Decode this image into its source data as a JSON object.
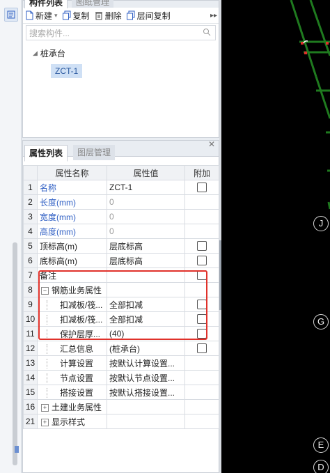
{
  "component_panel": {
    "tabs": [
      "构件列表",
      "图纸管理"
    ],
    "toolbar": {
      "new": "新建",
      "copy": "复制",
      "delete": "删除",
      "layer_copy": "层间复制"
    },
    "search_placeholder": "搜索构件...",
    "tree_root": "桩承台",
    "tree_child": "ZCT-1"
  },
  "property_panel": {
    "tabs": [
      "属性列表",
      "图层管理"
    ],
    "headers": {
      "name": "属性名称",
      "value": "属性值",
      "extra": "附加"
    },
    "rows": [
      {
        "num": "1",
        "name": "名称",
        "value": "ZCT-1",
        "check": true
      },
      {
        "num": "2",
        "name": "长度(mm)",
        "value": "0"
      },
      {
        "num": "3",
        "name": "宽度(mm)",
        "value": "0"
      },
      {
        "num": "4",
        "name": "高度(mm)",
        "value": "0"
      },
      {
        "num": "5",
        "name": "顶标高(m)",
        "value": "层底标高",
        "check": true
      },
      {
        "num": "6",
        "name": "底标高(m)",
        "value": "层底标高",
        "check": true
      },
      {
        "num": "7",
        "name": "备注",
        "value": "",
        "check": true
      },
      {
        "num": "8",
        "name": "钢筋业务属性",
        "value": ""
      },
      {
        "num": "9",
        "name": "扣减板/筏...",
        "value": "全部扣减",
        "check": true
      },
      {
        "num": "10",
        "name": "扣减板/筏...",
        "value": "全部扣减",
        "check": true
      },
      {
        "num": "11",
        "name": "保护层厚...",
        "value": "(40)",
        "check": true
      },
      {
        "num": "12",
        "name": "汇总信息",
        "value": "(桩承台)",
        "check": true
      },
      {
        "num": "13",
        "name": "计算设置",
        "value": "按默认计算设置..."
      },
      {
        "num": "14",
        "name": "节点设置",
        "value": "按默认节点设置..."
      },
      {
        "num": "15",
        "name": "搭接设置",
        "value": "按默认搭接设置..."
      },
      {
        "num": "16",
        "name": "土建业务属性",
        "value": ""
      },
      {
        "num": "21",
        "name": "显示样式",
        "value": ""
      }
    ]
  },
  "canvas": {
    "axis_labels": [
      "J",
      "G",
      "E",
      "D"
    ],
    "colors": {
      "background": "#000000",
      "beam": "#1f7a1f",
      "highlight": "#e0312a"
    }
  }
}
